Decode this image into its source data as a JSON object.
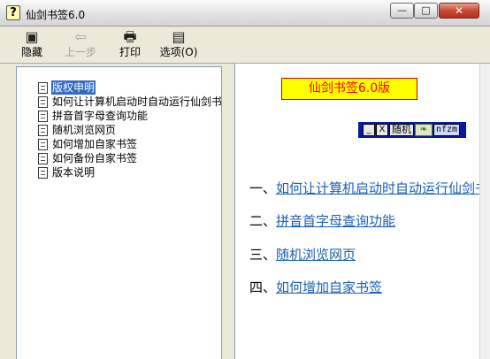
{
  "window": {
    "title": "仙剑书签6.0",
    "app_icon_glyph": "?",
    "controls": {
      "minimize": "—",
      "maximize": "□",
      "close": "✕"
    }
  },
  "toolbar": {
    "hide": {
      "label": "隐藏",
      "icon": "hide-panel-icon",
      "glyph": "▣"
    },
    "back": {
      "label": "上一步",
      "icon": "back-arrow-icon",
      "glyph": "⇦",
      "enabled": false
    },
    "print": {
      "label": "打印",
      "icon": "printer-icon",
      "glyph": "🖶"
    },
    "options": {
      "label": "选项(O)",
      "icon": "options-icon",
      "glyph": "▤"
    }
  },
  "sidebar": {
    "items": [
      {
        "label": "版权申明",
        "selected": true
      },
      {
        "label": "如何让计算机启动时自动运行仙剑书"
      },
      {
        "label": "拼音首字母查询功能"
      },
      {
        "label": "随机浏览网页"
      },
      {
        "label": "如何增加自家书签"
      },
      {
        "label": "如何备份自家书签"
      },
      {
        "label": "版本说明"
      }
    ]
  },
  "content": {
    "title": "仙剑书签6.0版",
    "mini_toolbar": {
      "min": "_",
      "close": "X",
      "random": "随机",
      "leaf": "❧",
      "code": "nfzm"
    },
    "links": [
      {
        "number": "一、",
        "text": "如何让计算机启动时自动运行仙剑书签"
      },
      {
        "number": "二、",
        "text": "拼音首字母查询功能"
      },
      {
        "number": "三、",
        "text": "随机浏览网页"
      },
      {
        "number": "四、",
        "text": "如何增加自家书签"
      }
    ]
  },
  "colors": {
    "accent": "#316ac5",
    "title_bg": "#ffff00",
    "title_text": "#ff0000",
    "link": "#1a5fb4",
    "mini_bar": "#0a1aa0"
  }
}
